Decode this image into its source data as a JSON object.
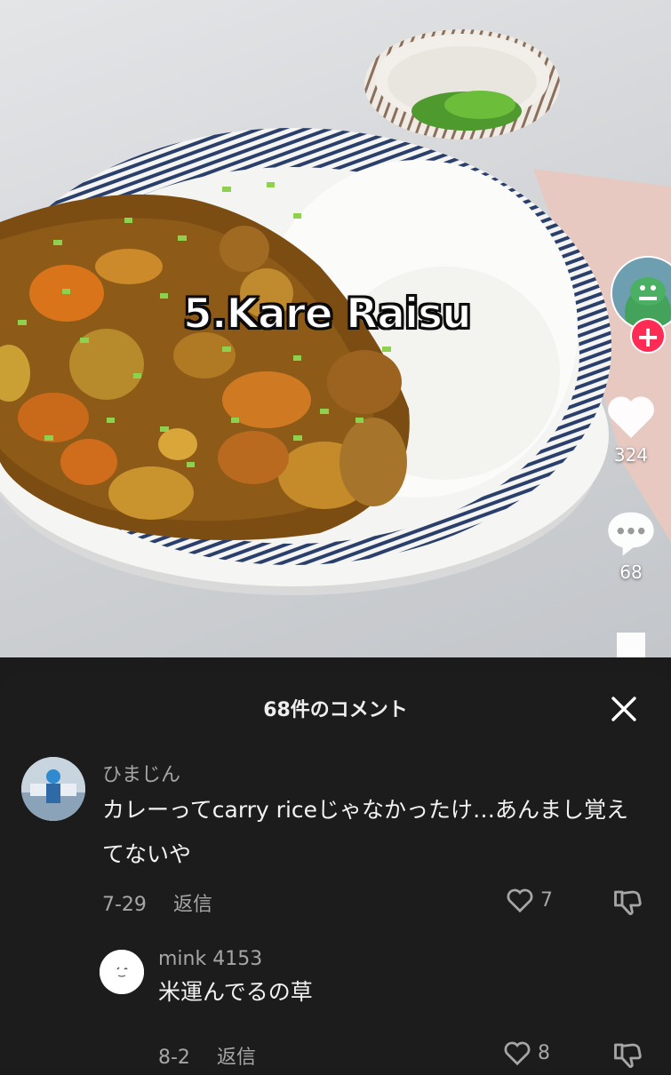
{
  "video": {
    "overlay_title": "5.Kare Raisu",
    "like_count": "324",
    "comment_count": "68",
    "icons": [
      "heart-icon",
      "comment-bubble-icon",
      "bookmark-icon",
      "plus-icon"
    ],
    "colors": {
      "follow": "#fe2c55"
    }
  },
  "comments_panel": {
    "title": "68件のコメント",
    "close_icon": "close-icon",
    "comments": [
      {
        "user": "ひまじん",
        "text": "カレーってcarry riceじゃなかったけ…あんまし覚えてないや",
        "date": "7-29",
        "reply_label": "返信",
        "likes": "7"
      },
      {
        "user": "mink 4153",
        "text": "米運んでるの草",
        "date": "8-2",
        "reply_label": "返信",
        "likes": "8"
      }
    ]
  }
}
